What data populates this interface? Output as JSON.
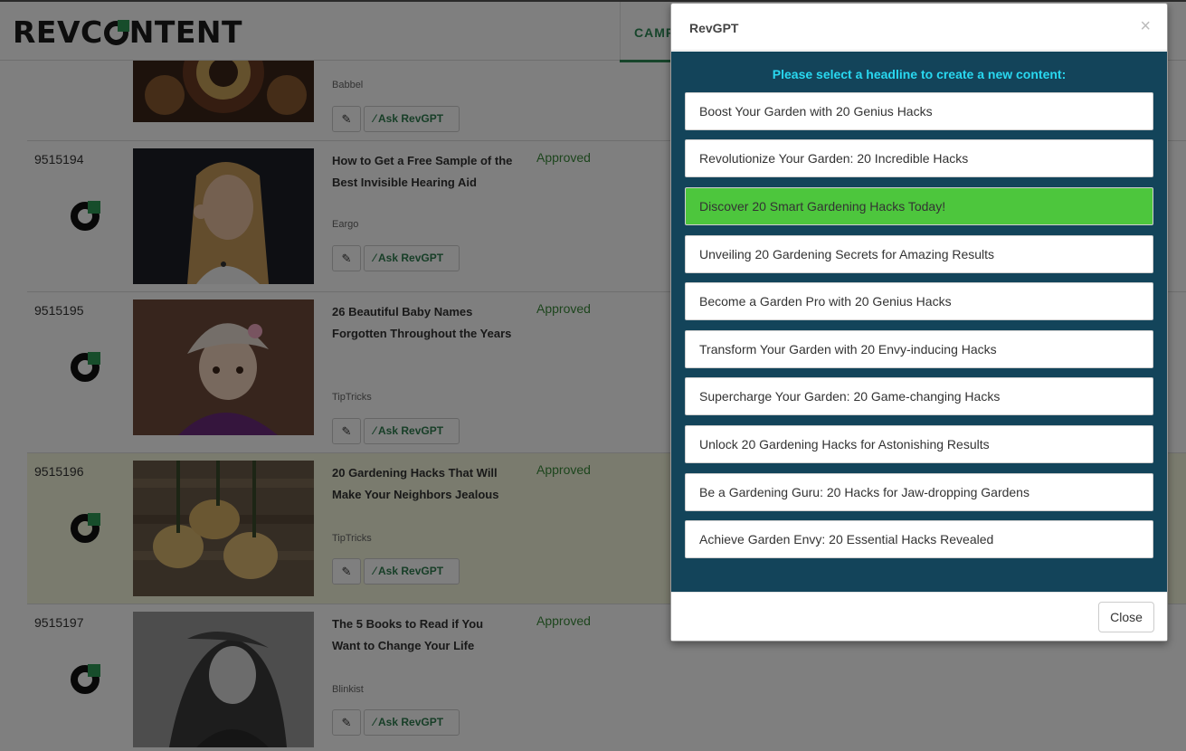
{
  "header": {
    "logo_text_left": "REVC",
    "logo_text_right": "NTENT",
    "nav_tab_label": "CAMPAIGNS"
  },
  "rows": [
    {
      "id": "",
      "title": "",
      "brand": "Babbel",
      "status": "",
      "edit_icon": "pencil-icon",
      "ask_label": "Ask RevGPT"
    },
    {
      "id": "9515194",
      "title": "How to Get a Free Sample of the Best Invisible Hearing Aid",
      "brand": "Eargo",
      "status": "Approved",
      "edit_icon": "pencil-icon",
      "ask_label": "Ask RevGPT"
    },
    {
      "id": "9515195",
      "title": "26 Beautiful Baby Names Forgotten Throughout the Years",
      "brand": "TipTricks",
      "status": "Approved",
      "edit_icon": "pencil-icon",
      "ask_label": "Ask RevGPT"
    },
    {
      "id": "9515196",
      "title": "20 Gardening Hacks That Will Make Your Neighbors Jealous",
      "brand": "TipTricks",
      "status": "Approved",
      "edit_icon": "pencil-icon",
      "ask_label": "Ask RevGPT"
    },
    {
      "id": "9515197",
      "title": "The 5 Books to Read if You Want to Change Your Life",
      "brand": "Blinkist",
      "status": "Approved",
      "edit_icon": "pencil-icon",
      "ask_label": "Ask RevGPT"
    }
  ],
  "modal": {
    "title": "RevGPT",
    "close_x": "×",
    "prompt": "Please select a headline to create a new content:",
    "headlines": [
      "Boost Your Garden with 20 Genius Hacks",
      "Revolutionize Your Garden: 20 Incredible Hacks",
      "Discover 20 Smart Gardening Hacks Today!",
      "Unveiling 20 Gardening Secrets for Amazing Results",
      "Become a Garden Pro with 20 Genius Hacks",
      "Transform Your Garden with 20 Envy-inducing Hacks",
      "Supercharge Your Garden: 20 Game-changing Hacks",
      "Unlock 20 Gardening Hacks for Astonishing Results",
      "Be a Gardening Guru: 20 Hacks for Jaw-dropping Gardens",
      "Achieve Garden Envy: 20 Essential Hacks Revealed"
    ],
    "selected_headline": "Discover 20 Smart Gardening Hacks Today!",
    "close_button": "Close"
  },
  "colors": {
    "modal_body_bg": "#13445a",
    "prompt_text": "#29d8f0",
    "selected_item": "#4dc63d",
    "approved_text": "#3b8b3b",
    "brand_green": "#2e9a57"
  }
}
